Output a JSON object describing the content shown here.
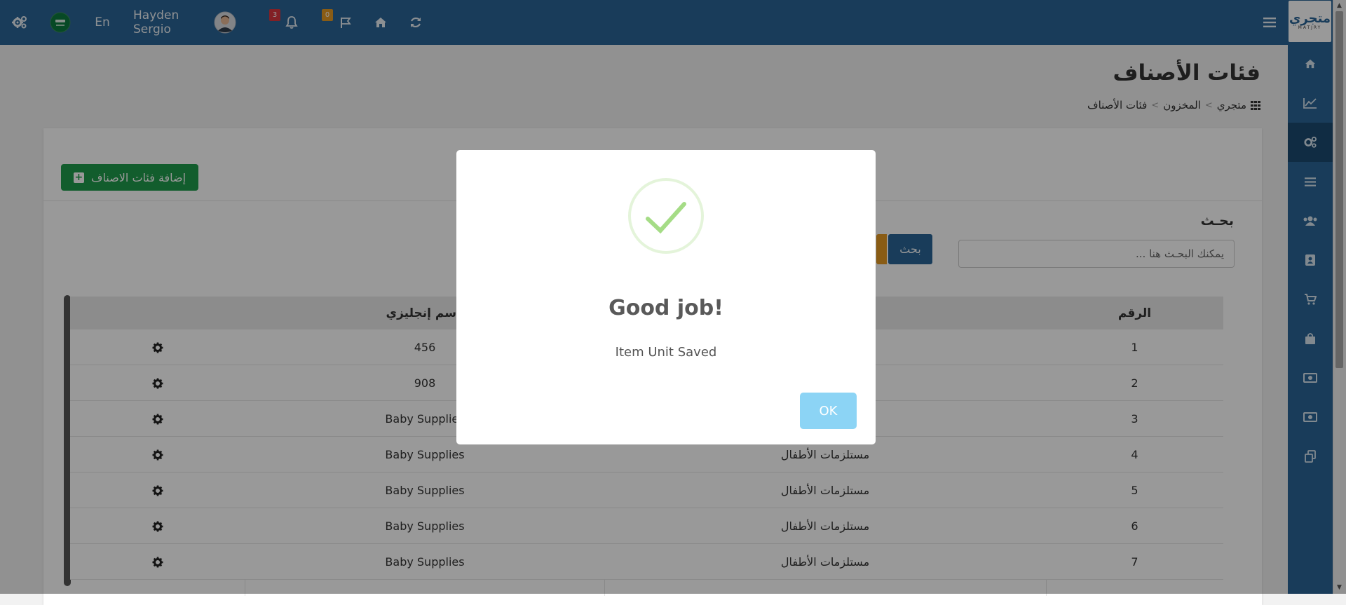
{
  "topbar": {
    "lang_label": "En",
    "user_name": "Hayden Sergio",
    "notifications_count": "3",
    "flags_count": "0",
    "colors": {
      "bar": "#2a6596",
      "notif_badge": "#d9363e",
      "flag_badge": "#e59a23"
    }
  },
  "logo": {
    "text": "متجري",
    "subtext": "MATJRY"
  },
  "sidebar": {
    "items": [
      {
        "icon": "home-icon"
      },
      {
        "icon": "chart-line-icon"
      },
      {
        "icon": "cogs-icon",
        "active": true
      },
      {
        "icon": "list-icon"
      },
      {
        "icon": "users-icon"
      },
      {
        "icon": "address-book-icon"
      },
      {
        "icon": "cart-icon"
      },
      {
        "icon": "shopping-bag-icon"
      },
      {
        "icon": "money-icon"
      },
      {
        "icon": "money-icon"
      },
      {
        "icon": "copy-icon"
      }
    ]
  },
  "page": {
    "title": "فئات الأصناف",
    "breadcrumb": [
      "متجري",
      "المخزون",
      "فئات الأصناف"
    ]
  },
  "toolbar": {
    "add_label": "إضافة فئات الاصناف"
  },
  "search": {
    "label": "بحـث",
    "placeholder": "يمكنك البحـث هنا ...",
    "button_label": "بحث"
  },
  "table": {
    "headers": {
      "number": "الرقم",
      "english_name": "الاسم إنجليزي"
    },
    "rows": [
      {
        "number": "1",
        "arabic": "",
        "english": "456"
      },
      {
        "number": "2",
        "arabic": "",
        "english": "908"
      },
      {
        "number": "3",
        "arabic": "",
        "english": "Baby Supplies"
      },
      {
        "number": "4",
        "arabic": "مستلزمات الأطفال",
        "english": "Baby Supplies"
      },
      {
        "number": "5",
        "arabic": "مستلزمات الأطفال",
        "english": "Baby Supplies"
      },
      {
        "number": "6",
        "arabic": "مستلزمات الأطفال",
        "english": "Baby Supplies"
      },
      {
        "number": "7",
        "arabic": "مستلزمات الأطفال",
        "english": "Baby Supplies"
      }
    ]
  },
  "modal": {
    "title": "Good job!",
    "text": "Item Unit Saved",
    "ok_label": "OK",
    "icon": "success-check-icon"
  }
}
